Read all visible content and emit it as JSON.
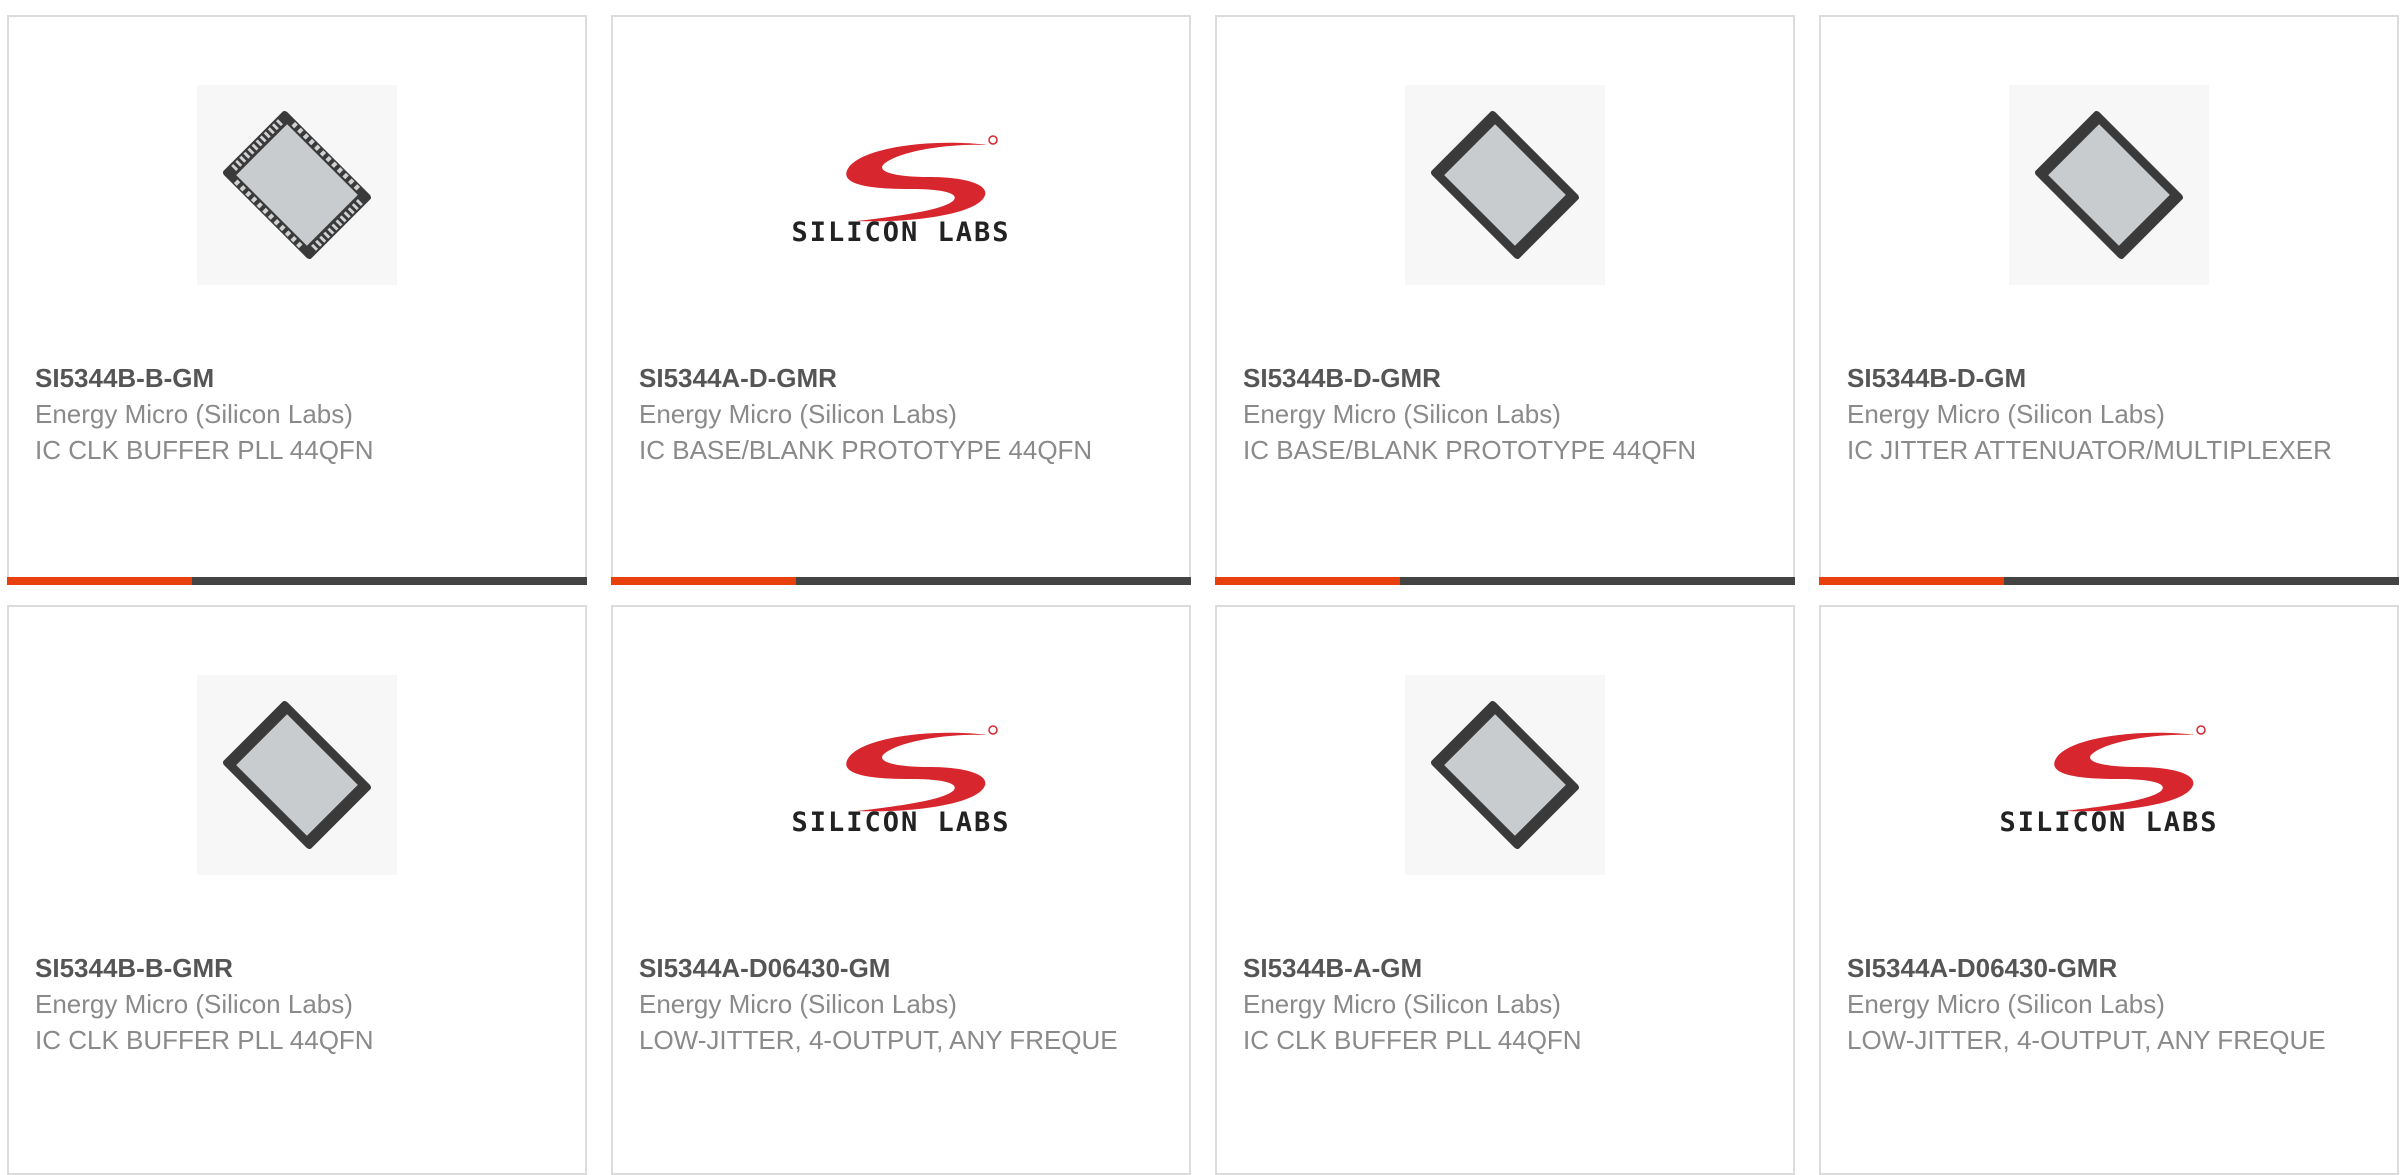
{
  "colors": {
    "accent": "#e8400c",
    "bar_dark": "#444444",
    "part_text": "#555555",
    "muted_text": "#8a8a8a",
    "logo_red": "#d7262d",
    "chip_body": "#3a3a3a",
    "chip_top": "#c9cccf"
  },
  "products": [
    {
      "part": "SI5344B-B-GM",
      "manufacturer": "Energy Micro (Silicon Labs)",
      "description": "IC CLK BUFFER PLL 44QFN",
      "image": "qfn-chip-icon"
    },
    {
      "part": "SI5344A-D-GMR",
      "manufacturer": "Energy Micro (Silicon Labs)",
      "description": "IC BASE/BLANK PROTOTYPE 44QFN",
      "image": "silicon-labs-logo",
      "logo_text": "SILICON LABS"
    },
    {
      "part": "SI5344B-D-GMR",
      "manufacturer": "Energy Micro (Silicon Labs)",
      "description": "IC BASE/BLANK PROTOTYPE 44QFN",
      "image": "qfn-chip-icon"
    },
    {
      "part": "SI5344B-D-GM",
      "manufacturer": "Energy Micro (Silicon Labs)",
      "description": "IC JITTER ATTENUATOR/MULTIPLEXER",
      "image": "qfn-chip-icon"
    },
    {
      "part": "SI5344B-B-GMR",
      "manufacturer": "Energy Micro (Silicon Labs)",
      "description": "IC CLK BUFFER PLL 44QFN",
      "image": "qfn-chip-icon"
    },
    {
      "part": "SI5344A-D06430-GM",
      "manufacturer": "Energy Micro (Silicon Labs)",
      "description": "LOW-JITTER, 4-OUTPUT, ANY FREQUE",
      "image": "silicon-labs-logo",
      "logo_text": "SILICON LABS"
    },
    {
      "part": "SI5344B-A-GM",
      "manufacturer": "Energy Micro (Silicon Labs)",
      "description": "IC CLK BUFFER PLL 44QFN",
      "image": "qfn-chip-icon"
    },
    {
      "part": "SI5344A-D06430-GMR",
      "manufacturer": "Energy Micro (Silicon Labs)",
      "description": "LOW-JITTER, 4-OUTPUT, ANY FREQUE",
      "image": "silicon-labs-logo",
      "logo_text": "SILICON LABS"
    }
  ]
}
